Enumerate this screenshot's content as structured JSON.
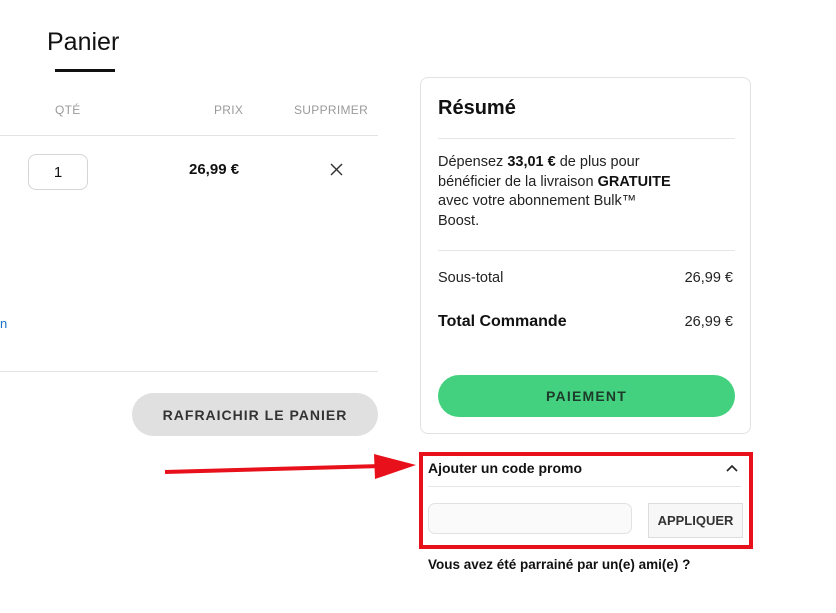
{
  "cart": {
    "title": "Panier",
    "columns": {
      "qty": "QTÉ",
      "price": "PRIX",
      "remove": "SUPPRIMER"
    },
    "item": {
      "quantity": "1",
      "price": "26,99 €"
    },
    "refresh_label": "RAFRAICHIR LE PANIER",
    "link_fragment": "n"
  },
  "summary": {
    "title": "Résumé",
    "promo": {
      "part1": "Dépensez ",
      "amount": "33,01 €",
      "part2": " de plus pour bénéficier de la livraison ",
      "free": "GRATUITE",
      "part3": " avec votre abonnement Bulk™ Boost."
    },
    "subtotal_label": "Sous-total",
    "subtotal_value": "26,99 €",
    "total_label": "Total Commande",
    "total_value": "26,99 €",
    "pay_label": "PAIEMENT"
  },
  "coupon": {
    "label": "Ajouter un code promo",
    "input_value": "",
    "apply_label": "APPLIQUER",
    "referral_text": "Vous avez été parrainé par un(e) ami(e) ?"
  },
  "colors": {
    "accent_green": "#44d17f",
    "annotation_red": "#e8101a"
  },
  "icons": {
    "remove": "close-icon",
    "coupon_toggle": "chevron-up-icon"
  }
}
